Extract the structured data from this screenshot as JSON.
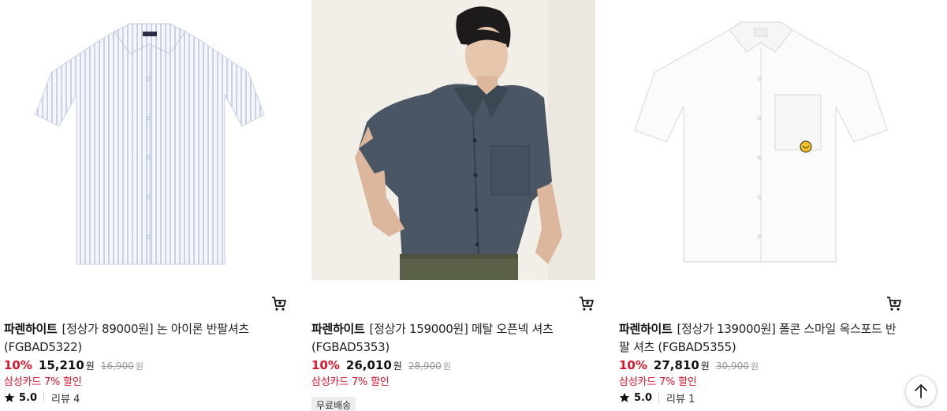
{
  "products": [
    {
      "brand": "파렌하이트",
      "name": "[정상가 89000원] 논 아이론 반팔셔츠 (FGBAD5322)",
      "discount_pct": "10%",
      "sale_price": "15,210",
      "currency": "원",
      "original_price": "16,900",
      "card_discount": "삼성카드 7% 할인",
      "rating": "5.0",
      "reviews": "리뷰 4",
      "image_icon": "striped-shirt-image"
    },
    {
      "brand": "파렌하이트",
      "name": "[정상가 159000원] 메탈 오픈넥 셔츠 (FGBAD5353)",
      "discount_pct": "10%",
      "sale_price": "26,010",
      "currency": "원",
      "original_price": "28,900",
      "card_discount": "삼성카드 7% 할인",
      "badge": "무료배송",
      "image_icon": "model-navy-shirt-image"
    },
    {
      "brand": "파렌하이트",
      "name": "[정상가 139000원] 폴콘 스마일 옥스포드 반팔 셔츠 (FGBAD5355)",
      "discount_pct": "10%",
      "sale_price": "27,810",
      "currency": "원",
      "original_price": "30,900",
      "card_discount": "삼성카드 7% 할인",
      "rating": "5.0",
      "reviews": "리뷰 1",
      "image_icon": "white-oxford-shirt-image"
    }
  ],
  "icons": {
    "cart": "cart-add-icon",
    "star": "star-icon",
    "scroll_top": "arrow-up-icon"
  },
  "colors": {
    "discount": "#e0152a",
    "text": "#111111",
    "muted": "#999999",
    "badge_bg": "#eeeeee"
  }
}
